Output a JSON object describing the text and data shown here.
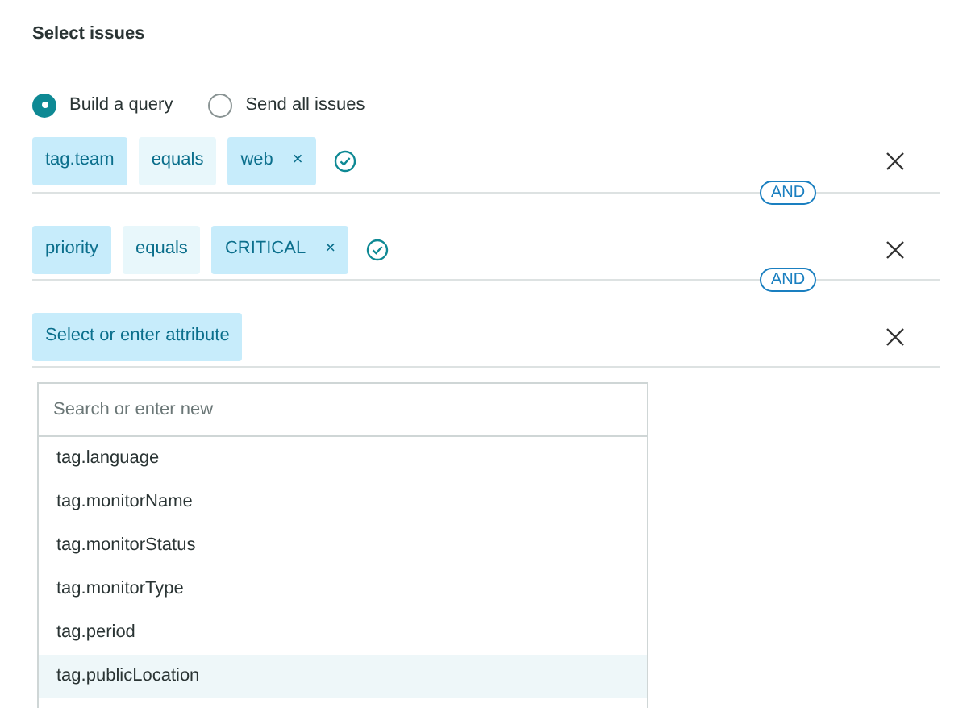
{
  "section_title": "Select issues",
  "radios": [
    {
      "label": "Build a query",
      "selected": true
    },
    {
      "label": "Send all issues",
      "selected": false
    }
  ],
  "conditions": [
    {
      "attribute": "tag.team",
      "operator": "equals",
      "value": "web",
      "remove": "×",
      "confirmed": true,
      "connector": "AND"
    },
    {
      "attribute": "priority",
      "operator": "equals",
      "value": "CRITICAL",
      "remove": "×",
      "confirmed": true,
      "connector": "AND"
    },
    {
      "attribute": "Select or enter attribute",
      "confirmed": false
    }
  ],
  "dropdown": {
    "placeholder": "Search or enter new",
    "options": [
      {
        "label": "tag.language",
        "selected": false
      },
      {
        "label": "tag.monitorName",
        "selected": false
      },
      {
        "label": "tag.monitorStatus",
        "selected": false
      },
      {
        "label": "tag.monitorType",
        "selected": false
      },
      {
        "label": "tag.period",
        "selected": false
      },
      {
        "label": "tag.publicLocation",
        "selected": true
      }
    ]
  }
}
